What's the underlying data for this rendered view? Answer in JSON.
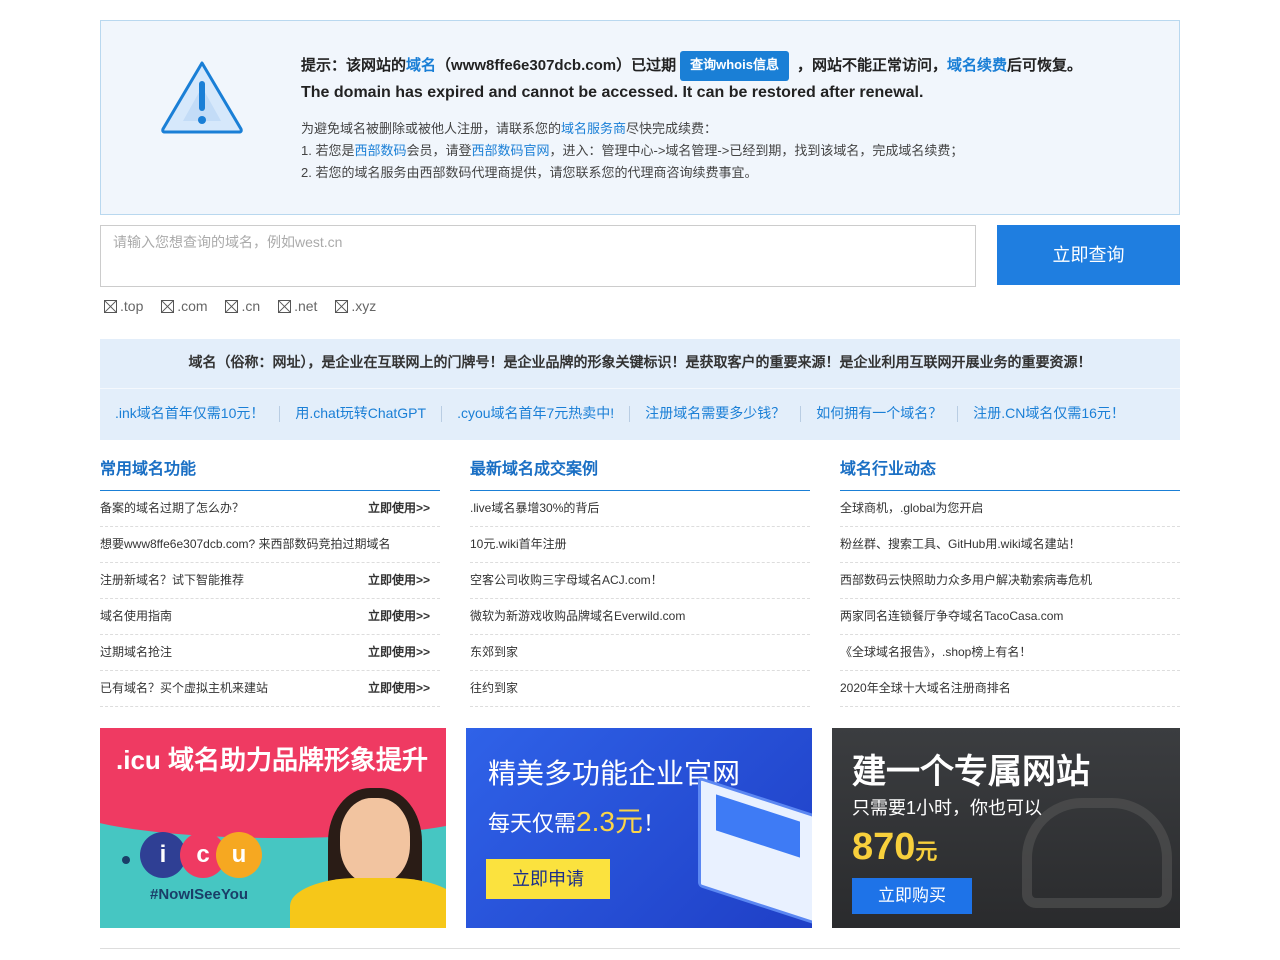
{
  "notice": {
    "title_prefix": "提示：该网站的",
    "title_link": "域名",
    "title_domain": "（www8ffe6e307dcb.com）已过期",
    "whois_button": "查询whois信息",
    "title_middle": "，网站不能正常访问，",
    "title_link2": "域名续费",
    "title_suffix": "后可恢复。",
    "english": "The domain has expired and cannot be accessed. It can be restored after renewal.",
    "line1_a": "为避免域名被删除或被他人注册，请联系您的",
    "line1_link": "域名服务商",
    "line1_b": "尽快完成续费：",
    "line2_a": "1. 若您是",
    "line2_link1": "西部数码",
    "line2_b": "会员，请登",
    "line2_link2": "西部数码官网",
    "line2_c": "，进入：管理中心->域名管理->已经到期，找到该域名，完成域名续费；",
    "line3": "2. 若您的域名服务由西部数码代理商提供，请您联系您的代理商咨询续费事宜。"
  },
  "search": {
    "placeholder": "请输入您想查询的域名，例如west.cn",
    "button": "立即查询",
    "tlds": [
      ".top",
      ".com",
      ".cn",
      ".net",
      ".xyz"
    ]
  },
  "banner": {
    "slogan": "域名（俗称：网址），是企业在互联网上的门牌号！是企业品牌的形象关键标识！是获取客户的重要来源！是企业利用互联网开展业务的重要资源！",
    "links": [
      ".ink域名首年仅需10元！",
      "用.chat玩转ChatGPT",
      ".cyou域名首年7元热卖中!",
      "注册域名需要多少钱？",
      "如何拥有一个域名？",
      "注册.CN域名仅需16元！"
    ]
  },
  "columns": {
    "common": {
      "title": "常用域名功能",
      "use_label": "立即使用>>",
      "rows": [
        "备案的域名过期了怎么办？",
        "想要www8ffe6e307dcb.com? 来西部数码竞拍过期域名",
        "注册新域名？试下智能推荐",
        "域名使用指南",
        "过期域名抢注",
        "已有域名？买个虚拟主机来建站"
      ]
    },
    "cases": {
      "title": "最新域名成交案例",
      "rows": [
        ".live域名暴增30%的背后",
        "10元.wiki首年注册",
        "空客公司收购三字母域名ACJ.com！",
        "微软为新游戏收购品牌域名Everwild.com",
        "东郊到家",
        "往约到家"
      ]
    },
    "news": {
      "title": "域名行业动态",
      "rows": [
        "全球商机，.global为您开启",
        "粉丝群、搜索工具、GitHub用.wiki域名建站！",
        "西部数码云快照助力众多用户解决勒索病毒危机",
        "两家同名连锁餐厅争夺域名TacoCasa.com",
        "《全球域名报告》，.shop榜上有名！",
        "2020年全球十大域名注册商排名"
      ]
    }
  },
  "ads": {
    "icu": {
      "title": ".icu 域名助力品牌形象提升",
      "tag": "#NowISeeYou",
      "letters": [
        "i",
        "c",
        "u"
      ]
    },
    "site": {
      "title": "精美多功能企业官网",
      "sub_prefix": "每天仅需",
      "price": "2.3元",
      "sub_suffix": "！",
      "button": "立即申请"
    },
    "build": {
      "title": "建一个专属网站",
      "sub": "只需要1小时，你也可以",
      "price": "870",
      "unit": "元",
      "button": "立即购买"
    }
  },
  "colors": {
    "accent": "#1a7fd6",
    "notice_bg": "#f1f6fc",
    "banner_bg": "#e3eefa"
  }
}
